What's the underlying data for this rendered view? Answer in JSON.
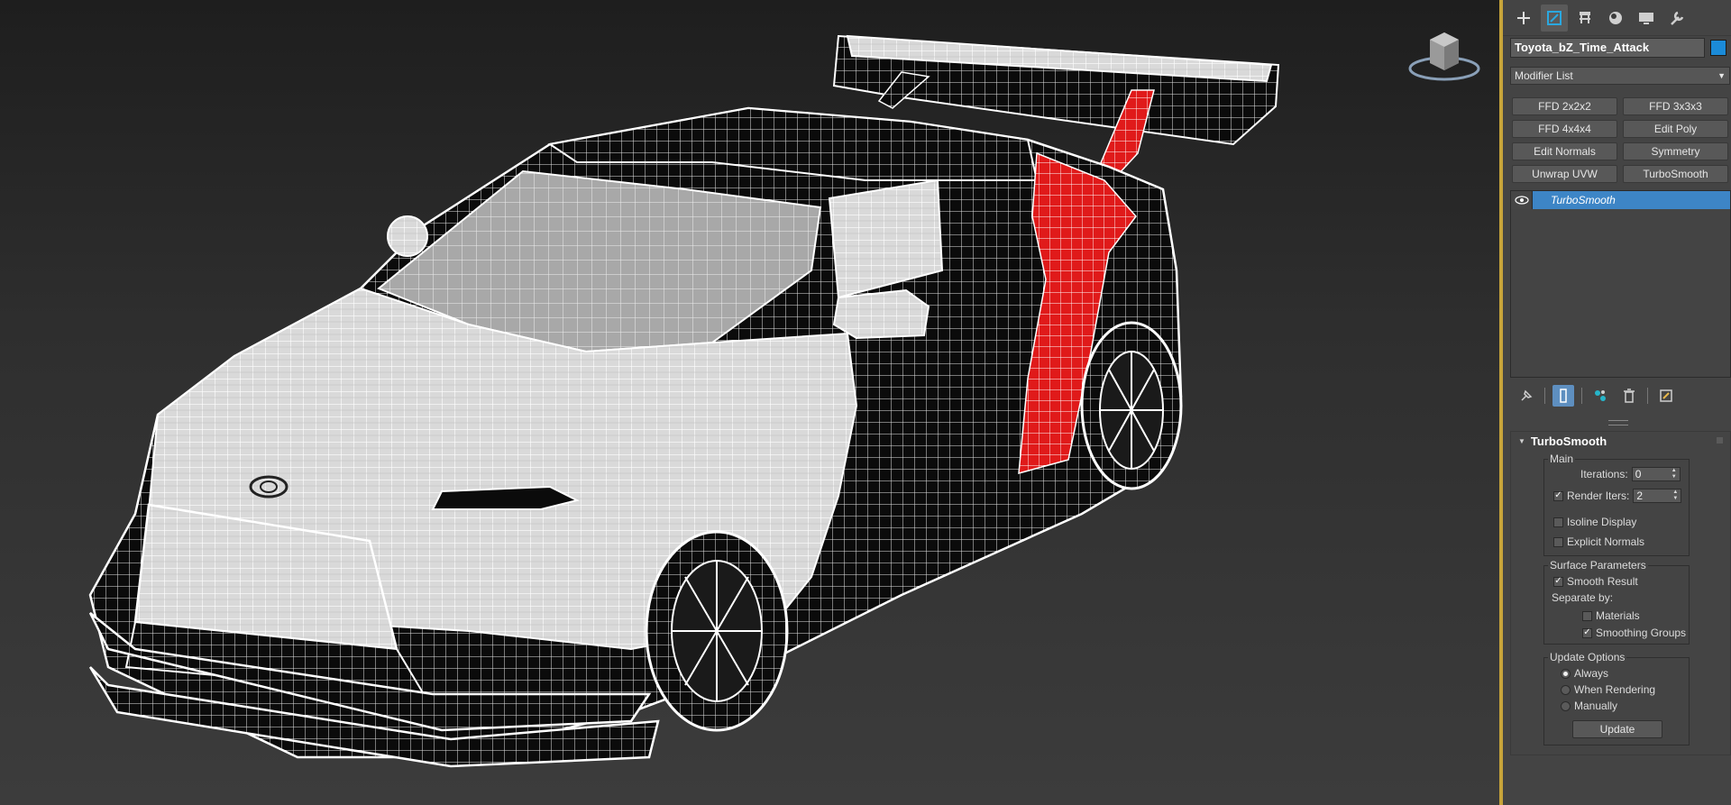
{
  "viewport": {
    "background_top": "#1e1e1e",
    "background_bottom": "#3c3c3c",
    "border_color": "#c7a43a",
    "viewcube_icon": "viewcube-icon",
    "scene_description_icons": [
      "car-wireframe"
    ]
  },
  "command_panel": {
    "tabs": [
      {
        "name": "create-icon",
        "active": false
      },
      {
        "name": "modify-icon",
        "active": true
      },
      {
        "name": "hierarchy-icon",
        "active": false
      },
      {
        "name": "motion-icon",
        "active": false
      },
      {
        "name": "display-icon",
        "active": false
      },
      {
        "name": "utilities-icon",
        "active": false
      }
    ],
    "object_name": "Toyota_bZ_Time_Attack",
    "object_color": "#1b8bd8",
    "modifier_list_label": "Modifier List",
    "modifier_buttons": [
      "FFD 2x2x2",
      "FFD 3x3x3",
      "FFD 4x4x4",
      "Edit Poly",
      "Edit Normals",
      "Symmetry",
      "Unwrap UVW",
      "TurboSmooth"
    ],
    "stack": {
      "items": [
        {
          "label": "TurboSmooth",
          "selected": true
        }
      ]
    },
    "stack_tools": [
      "pin-stack-icon",
      "show-end-result-icon",
      "make-unique-icon",
      "remove-modifier-icon",
      "configure-modifier-sets-icon"
    ],
    "turbosmooth": {
      "title": "TurboSmooth",
      "main": {
        "title": "Main",
        "iterations_label": "Iterations:",
        "iterations_value": "0",
        "render_iters_label": "Render Iters:",
        "render_iters_value": "2",
        "render_iters_checked": true,
        "isoline_label": "Isoline Display",
        "isoline_checked": false,
        "explicit_normals_label": "Explicit Normals",
        "explicit_normals_checked": false
      },
      "surface": {
        "title": "Surface Parameters",
        "smooth_result_label": "Smooth Result",
        "smooth_result_checked": true,
        "separate_by_label": "Separate by:",
        "materials_label": "Materials",
        "materials_checked": false,
        "smoothing_groups_label": "Smoothing Groups",
        "smoothing_groups_checked": true
      },
      "update": {
        "title": "Update Options",
        "always_label": "Always",
        "when_rendering_label": "When Rendering",
        "manually_label": "Manually",
        "selected": "Always",
        "update_button": "Update"
      }
    }
  }
}
